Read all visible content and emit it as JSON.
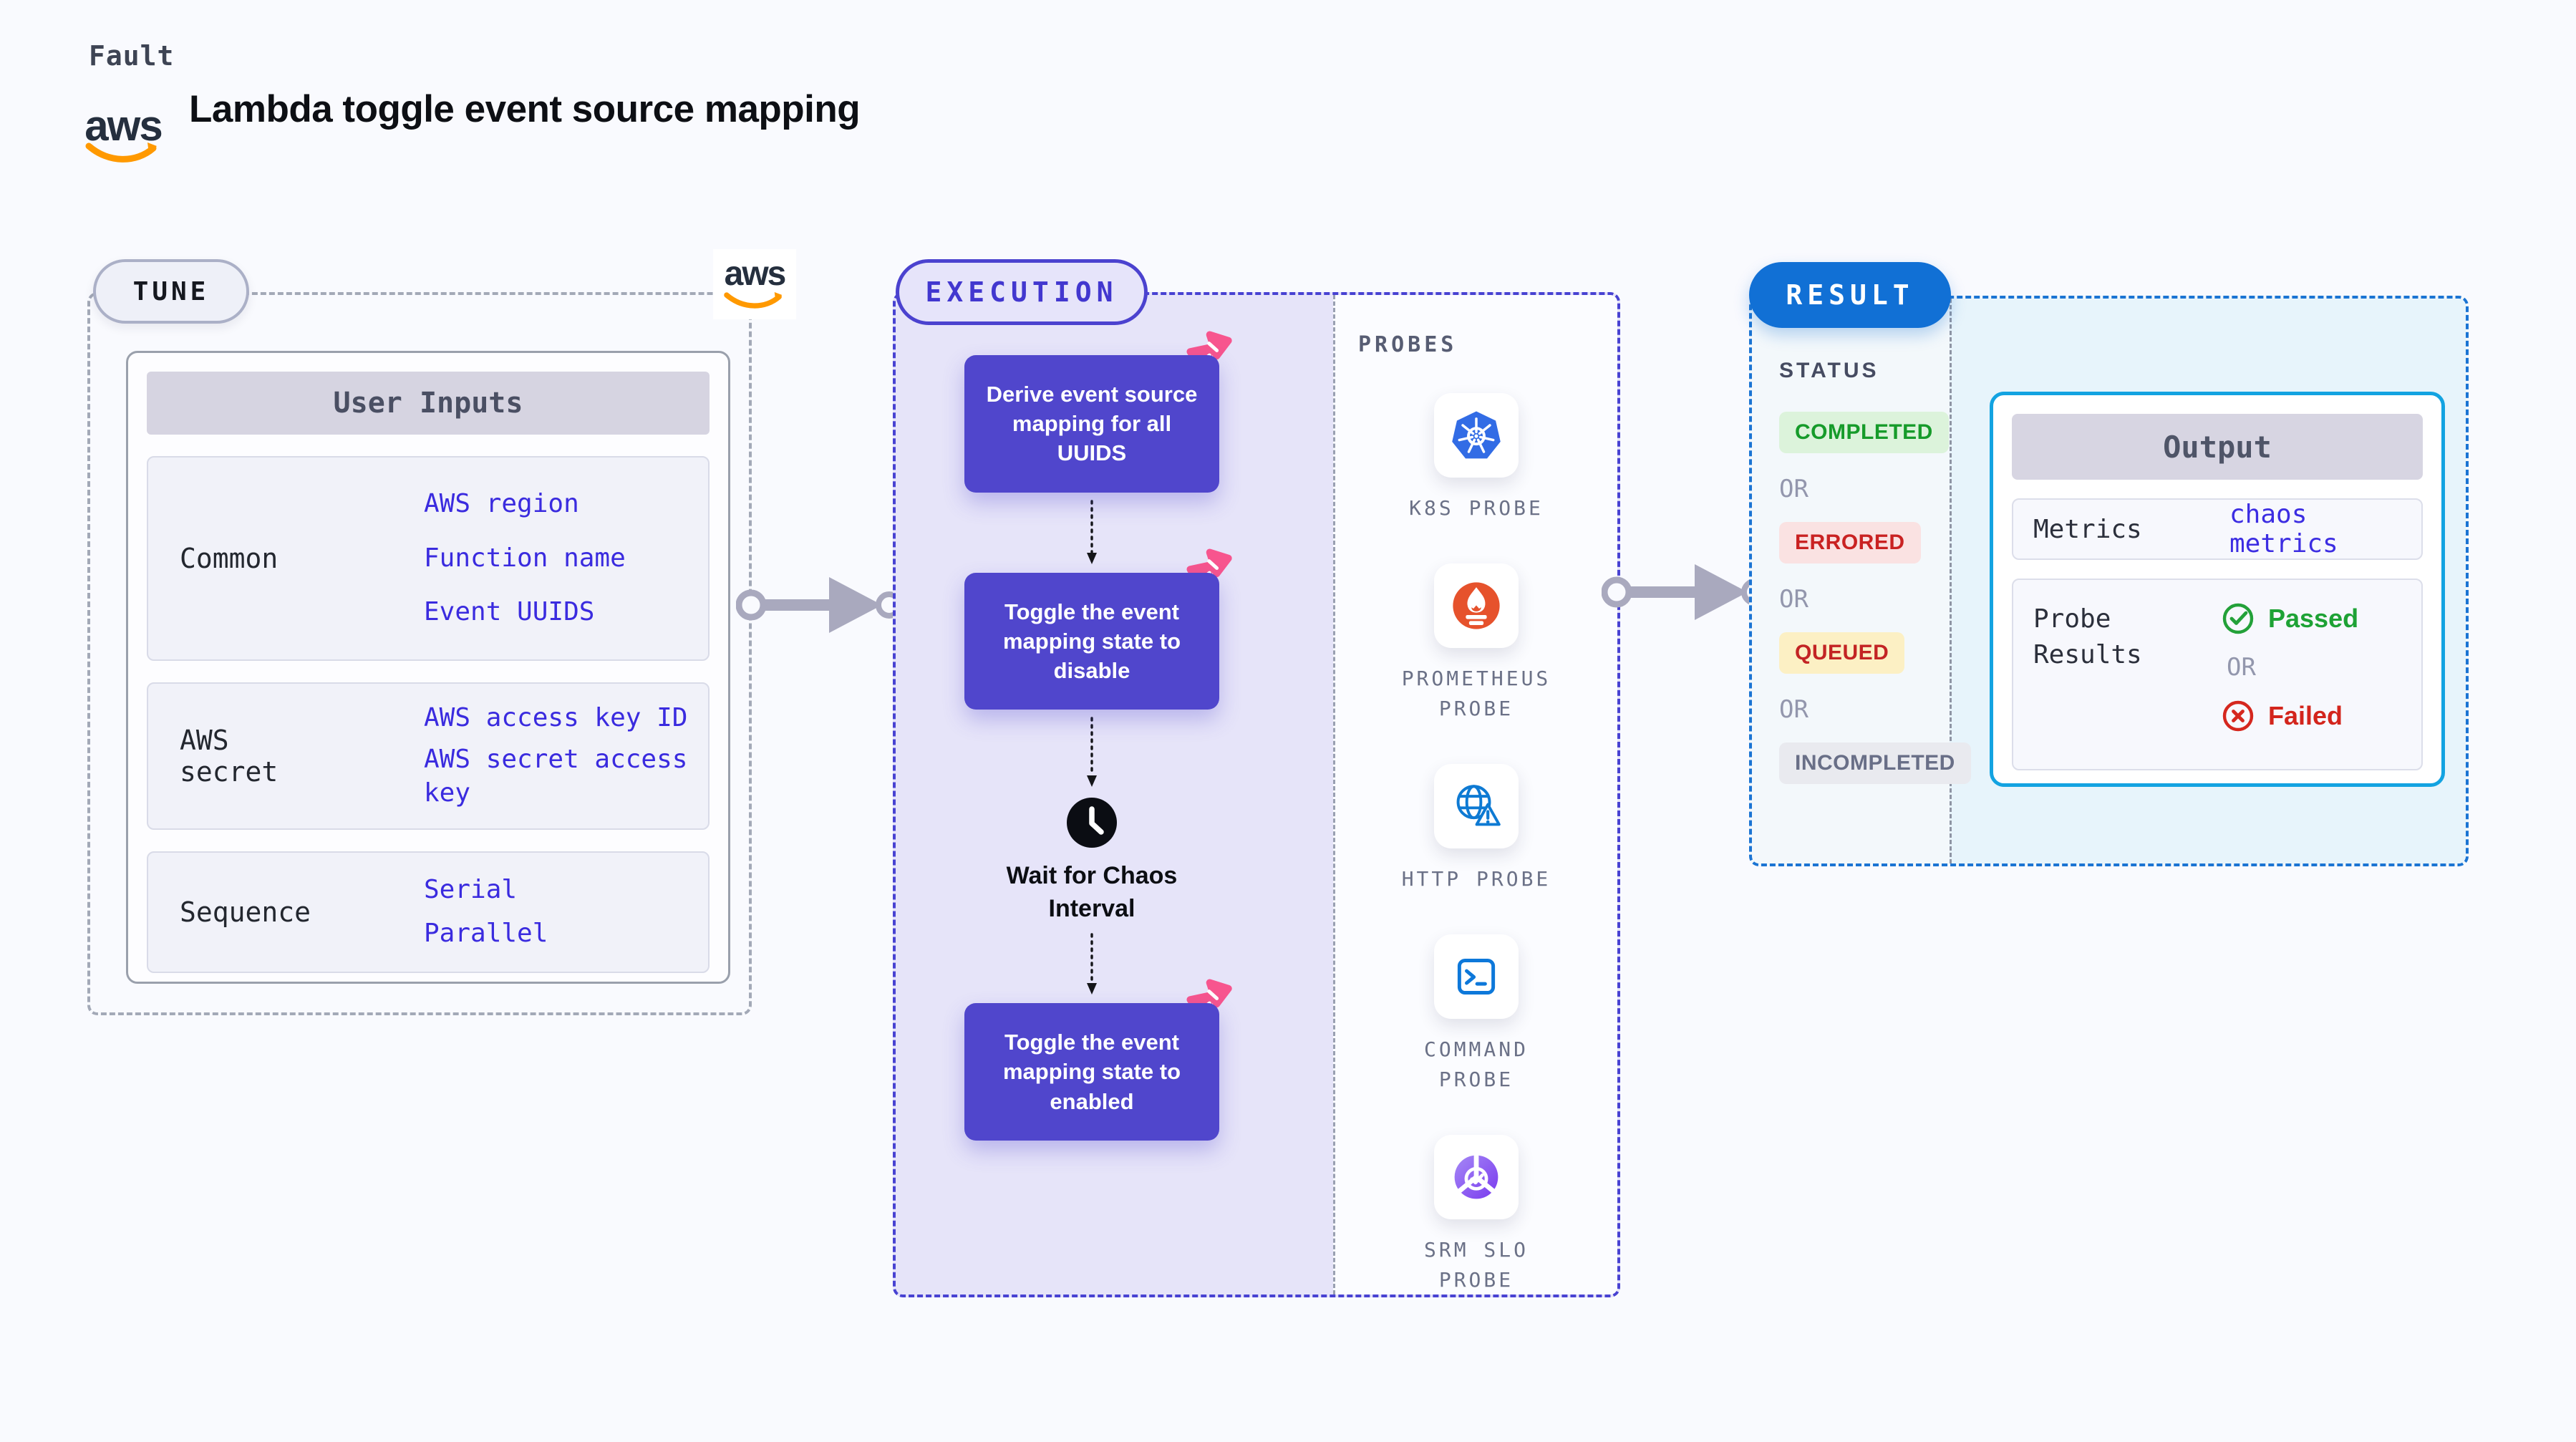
{
  "header": {
    "kicker": "Fault",
    "title": "Lambda toggle event source mapping",
    "aws_logo_text": "aws"
  },
  "tune": {
    "pill": "TUNE",
    "table": {
      "header": "User Inputs",
      "rows": [
        {
          "label": "Common",
          "links": [
            "AWS region",
            "Function name",
            "Event UUIDS"
          ]
        },
        {
          "label": "AWS secret",
          "links": [
            "AWS access key ID",
            "AWS secret access key"
          ]
        },
        {
          "label": "Sequence",
          "links": [
            "Serial",
            "Parallel"
          ]
        }
      ]
    }
  },
  "execution": {
    "pill": "EXECUTION",
    "steps": [
      "Derive event source mapping for all UUIDS",
      "Toggle the event mapping state to disable",
      "Toggle the event mapping state to enabled"
    ],
    "wait_label": "Wait for Chaos Interval"
  },
  "probes": {
    "label": "PROBES",
    "items": [
      {
        "name": "K8S PROBE",
        "icon": "kubernetes-icon"
      },
      {
        "name": "PROMETHEUS PROBE",
        "icon": "prometheus-icon"
      },
      {
        "name": "HTTP PROBE",
        "icon": "globe-warning-icon"
      },
      {
        "name": "COMMAND PROBE",
        "icon": "terminal-icon"
      },
      {
        "name": "SRM SLO PROBE",
        "icon": "slo-donut-check-icon"
      }
    ]
  },
  "result": {
    "pill": "RESULT",
    "status_label": "STATUS",
    "or_label": "OR",
    "statuses": [
      {
        "label": "COMPLETED",
        "bg": "#dcf3db",
        "color": "#169b2a"
      },
      {
        "label": "ERRORED",
        "bg": "#fae2e2",
        "color": "#c92222"
      },
      {
        "label": "QUEUED",
        "bg": "#fcf0c4",
        "color": "#c32424"
      },
      {
        "label": "INCOMPLETED",
        "bg": "#e9eaef",
        "color": "#696f87"
      }
    ],
    "output": {
      "header": "Output",
      "metrics_label": "Metrics",
      "metrics_link": "chaos metrics",
      "probe_results_label": "Probe Results",
      "passed": "Passed",
      "or_label": "OR",
      "failed": "Failed"
    }
  },
  "colors": {
    "accent_indigo": "#5046cc",
    "execution_border": "#4842d2",
    "result_blue": "#1170d5",
    "output_border": "#13a3e1",
    "link_blue": "#3a2bdf",
    "success_green": "#1ea235",
    "error_red": "#d3251c",
    "chaos_pink": "#f7558e",
    "arrow_gray": "#a9a9be"
  }
}
